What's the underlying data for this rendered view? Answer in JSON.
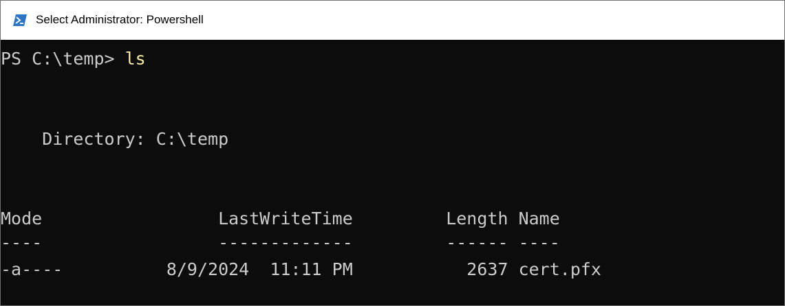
{
  "window": {
    "title": "Select Administrator: Powershell",
    "icon": "powershell-icon"
  },
  "console": {
    "prompt": "PS C:\\temp> ",
    "command": "ls",
    "directory_line": "    Directory: C:\\temp",
    "header_line": "Mode                 LastWriteTime         Length Name",
    "separator_line": "----                 -------------         ------ ----",
    "rows": [
      {
        "line": "-a----          8/9/2024  11:11 PM           2637 cert.pfx"
      }
    ]
  },
  "colors": {
    "background": "#0c0c0c",
    "text": "#cccccc",
    "command": "#f9f1a5",
    "titlebar": "#ffffff"
  }
}
